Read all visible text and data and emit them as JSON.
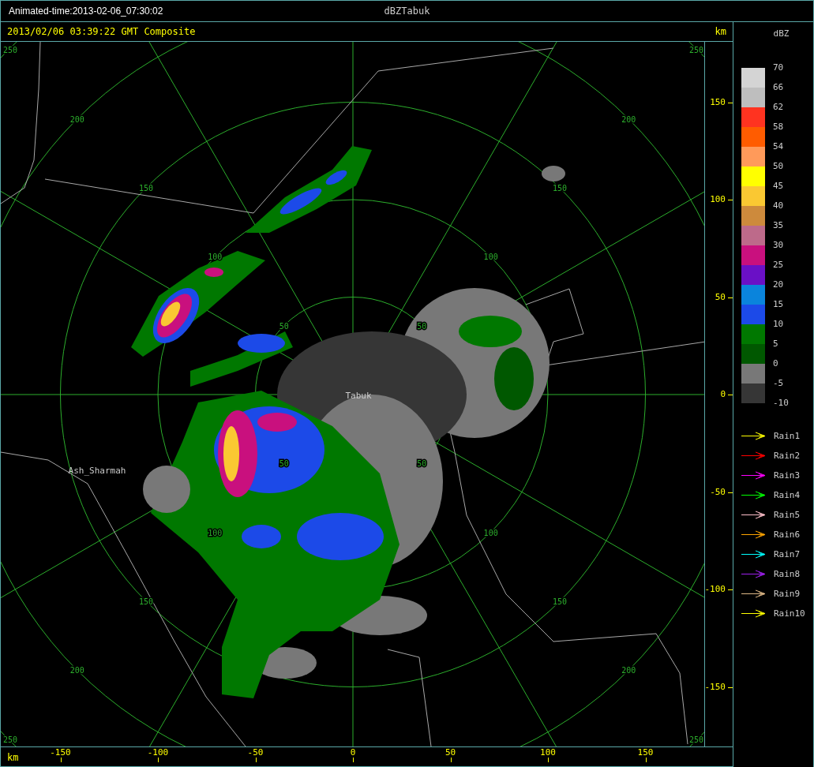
{
  "window": {
    "status": "Animated-time:2013-02-06_07:30:02",
    "title": "dBZTabuk"
  },
  "plot": {
    "header": "2013/02/06 03:39:22 GMT Composite",
    "y_unit": "km",
    "x_unit": "km",
    "x_ticks": [
      "-150",
      "-100",
      "-50",
      "0",
      "50",
      "100",
      "150"
    ],
    "y_ticks": [
      "150",
      "100",
      "50",
      "0",
      "-50",
      "-100",
      "-150"
    ],
    "rings": [
      {
        "labels": [
          "50",
          "50",
          "50",
          "50"
        ]
      },
      {
        "labels": [
          "100",
          "100",
          "100",
          "100"
        ]
      },
      {
        "labels": [
          "150",
          "150",
          "150",
          "150"
        ]
      },
      {
        "labels": [
          "200",
          "200",
          "200",
          "200"
        ]
      },
      {
        "labels": [
          "250",
          "250",
          "250",
          "250"
        ]
      }
    ],
    "places": [
      {
        "name": "Tabuk",
        "kind": "radar"
      },
      {
        "name": "Ash_Sharmah",
        "kind": "town"
      }
    ]
  },
  "legend": {
    "title": "dBZ",
    "scale": [
      {
        "color": "#d4d4d4"
      },
      {
        "color": "#bebebe"
      },
      {
        "color": "#ff3320"
      },
      {
        "color": "#ff5c00"
      },
      {
        "color": "#ff9a5a"
      },
      {
        "color": "#ffff00"
      },
      {
        "color": "#fac832"
      },
      {
        "color": "#cd8a3c"
      },
      {
        "color": "#bd6a8a"
      },
      {
        "color": "#c9107e"
      },
      {
        "color": "#6a10c6"
      },
      {
        "color": "#0a84dc"
      },
      {
        "color": "#1c4ae8"
      },
      {
        "color": "#007800"
      },
      {
        "color": "#005800"
      },
      {
        "color": "#787878"
      },
      {
        "color": "#363636"
      }
    ],
    "scale_labels": [
      "70",
      "66",
      "62",
      "58",
      "54",
      "50",
      "45",
      "40",
      "35",
      "30",
      "25",
      "20",
      "15",
      "10",
      "5",
      "0",
      "-5",
      "-10"
    ],
    "tracks": [
      {
        "label": "Rain1",
        "color": "#ffff00"
      },
      {
        "label": "Rain2",
        "color": "#ff0000"
      },
      {
        "label": "Rain3",
        "color": "#ff00ff"
      },
      {
        "label": "Rain4",
        "color": "#00ff00"
      },
      {
        "label": "Rain5",
        "color": "#ffc0cb"
      },
      {
        "label": "Rain6",
        "color": "#ffa500"
      },
      {
        "label": "Rain7",
        "color": "#00ffff"
      },
      {
        "label": "Rain8",
        "color": "#a020f0"
      },
      {
        "label": "Rain9",
        "color": "#deb887"
      },
      {
        "label": "Rain10",
        "color": "#ffff00"
      }
    ]
  }
}
